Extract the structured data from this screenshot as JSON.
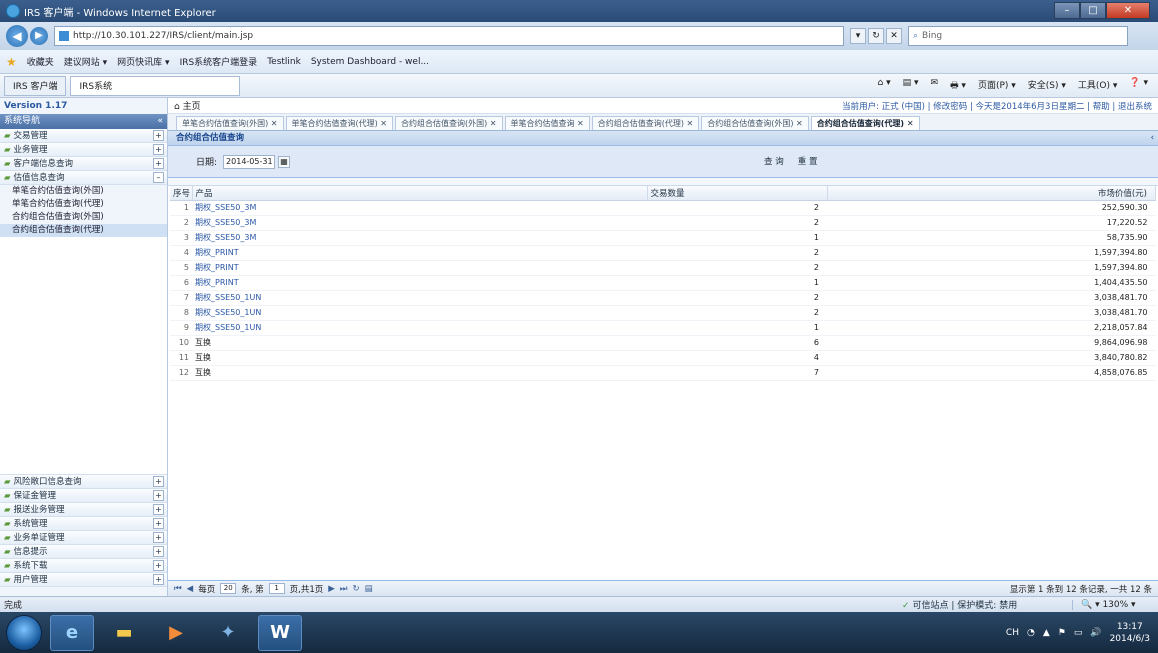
{
  "window": {
    "title": "IRS 客户端 - Windows Internet Explorer",
    "controls": {
      "minimize": "–",
      "maximize": "□",
      "close": "✕"
    }
  },
  "addressbar": {
    "back": "◀",
    "forward": "▶",
    "url": "http://10.30.101.227/IRS/client/main.jsp",
    "search_placeholder": "Bing",
    "tool_glyphs": [
      "▾",
      "↻",
      "✕"
    ]
  },
  "favorites": {
    "star": "★",
    "items": [
      "收藏夹",
      "建议网站 ▾",
      "网页快讯库 ▾",
      "IRS系统客户端登录",
      "Testlink",
      "System Dashboard - wel..."
    ]
  },
  "commandbar": {
    "tabs": [
      "IRS 客户端",
      "IRS系统"
    ],
    "items": [
      "⌂ ▾",
      "▤ ▾",
      "✉",
      "🖶 ▾",
      "页面(P) ▾",
      "安全(S) ▾",
      "工具(O) ▾",
      "❓ ▾"
    ]
  },
  "sidebar": {
    "version": "Version 1.17",
    "header": "系统导航",
    "collapse_glyph": "«",
    "top_items": [
      {
        "label": "交易管理",
        "toggle": "+"
      },
      {
        "label": "业务管理",
        "toggle": "+"
      },
      {
        "label": "客户端信息查询",
        "toggle": "+"
      },
      {
        "label": "估值信息查询",
        "toggle": "–"
      }
    ],
    "sub_items": [
      "单笔合约估值查询(外国)",
      "单笔合约估值查询(代理)",
      "合约组合估值查询(外国)",
      "合约组合估值查询(代理)"
    ],
    "bottom_items": [
      {
        "label": "风险敞口信息查询",
        "toggle": "+"
      },
      {
        "label": "保证金管理",
        "toggle": "+"
      },
      {
        "label": "报送业务管理",
        "toggle": "+"
      },
      {
        "label": "系统管理",
        "toggle": "+"
      },
      {
        "label": "业务单证管理",
        "toggle": "+"
      },
      {
        "label": "信息提示",
        "toggle": "+"
      },
      {
        "label": "系统下载",
        "toggle": "+"
      },
      {
        "label": "用户管理",
        "toggle": "+"
      }
    ]
  },
  "main": {
    "home": "⌂ 主页",
    "userinfo": "当前用户: 正式 (中国)  |  修改密码 | 今天是2014年6月3日星期二 | 帮助 | 退出系统",
    "tabs": [
      "单笔合约估值查询(外国) ✕",
      "单笔合约估值查询(代理) ✕",
      "合约组合估值查询(外国) ✕",
      "单笔合约估值查询 ✕",
      "合约组合估值查询(代理) ✕",
      "合约组合估值查询(外国) ✕",
      "合约组合估值查询(代理) ✕"
    ],
    "panel_title": "合约组合估值查询",
    "filter": {
      "date_label": "日期:",
      "date_value": "2014-05-31",
      "calendar_glyph": "▦",
      "query": "查 询",
      "reset": "重 置"
    },
    "columns": {
      "index": "序号",
      "product": "产品",
      "quantity": "交易数量",
      "value": "市场价值(元)"
    },
    "rows": [
      {
        "idx": "1",
        "product": "期权_SSE50_3M",
        "qty": "2",
        "value": "252,590.30",
        "link": true
      },
      {
        "idx": "2",
        "product": "期权_SSE50_3M",
        "qty": "2",
        "value": "17,220.52",
        "link": true
      },
      {
        "idx": "3",
        "product": "期权_SSE50_3M",
        "qty": "1",
        "value": "58,735.90",
        "link": true
      },
      {
        "idx": "4",
        "product": "期权_PRINT",
        "qty": "2",
        "value": "1,597,394.80",
        "link": true
      },
      {
        "idx": "5",
        "product": "期权_PRINT",
        "qty": "2",
        "value": "1,597,394.80",
        "link": true
      },
      {
        "idx": "6",
        "product": "期权_PRINT",
        "qty": "1",
        "value": "1,404,435.50",
        "link": true
      },
      {
        "idx": "7",
        "product": "期权_SSE50_1UN",
        "qty": "2",
        "value": "3,038,481.70",
        "link": true
      },
      {
        "idx": "8",
        "product": "期权_SSE50_1UN",
        "qty": "2",
        "value": "3,038,481.70",
        "link": true
      },
      {
        "idx": "9",
        "product": "期权_SSE50_1UN",
        "qty": "1",
        "value": "2,218,057.84",
        "link": true
      },
      {
        "idx": "10",
        "product": "互换",
        "qty": "6",
        "value": "9,864,096.98",
        "link": false
      },
      {
        "idx": "11",
        "product": "互换",
        "qty": "4",
        "value": "3,840,780.82",
        "link": false
      },
      {
        "idx": "12",
        "product": "互换",
        "qty": "7",
        "value": "4,858,076.85",
        "link": false
      }
    ],
    "pager": {
      "first": "⏮",
      "prev": "◀",
      "page_label": "每页",
      "page_size": "20",
      "page_label2": "条, 第",
      "page_no": "1",
      "page_label3": "页,共1页",
      "next": "▶",
      "last": "⏭",
      "refresh": "↻",
      "export": "▤",
      "info": "显示第 1 条到 12 条记录, 一共 12 条"
    }
  },
  "statusbar": {
    "left": "完成",
    "check": "✓",
    "protected": "可信站点 | 保护模式: 禁用",
    "zoom": "🔍 ▾  130%  ▾"
  },
  "taskbar": {
    "icons": [
      "e",
      "▬",
      "▶",
      "✦",
      "W"
    ],
    "tray_icons": [
      "CH",
      "◔",
      "▲",
      "⚑",
      "▭",
      "🔊"
    ],
    "time": "13:17",
    "date": "2014/6/3"
  }
}
